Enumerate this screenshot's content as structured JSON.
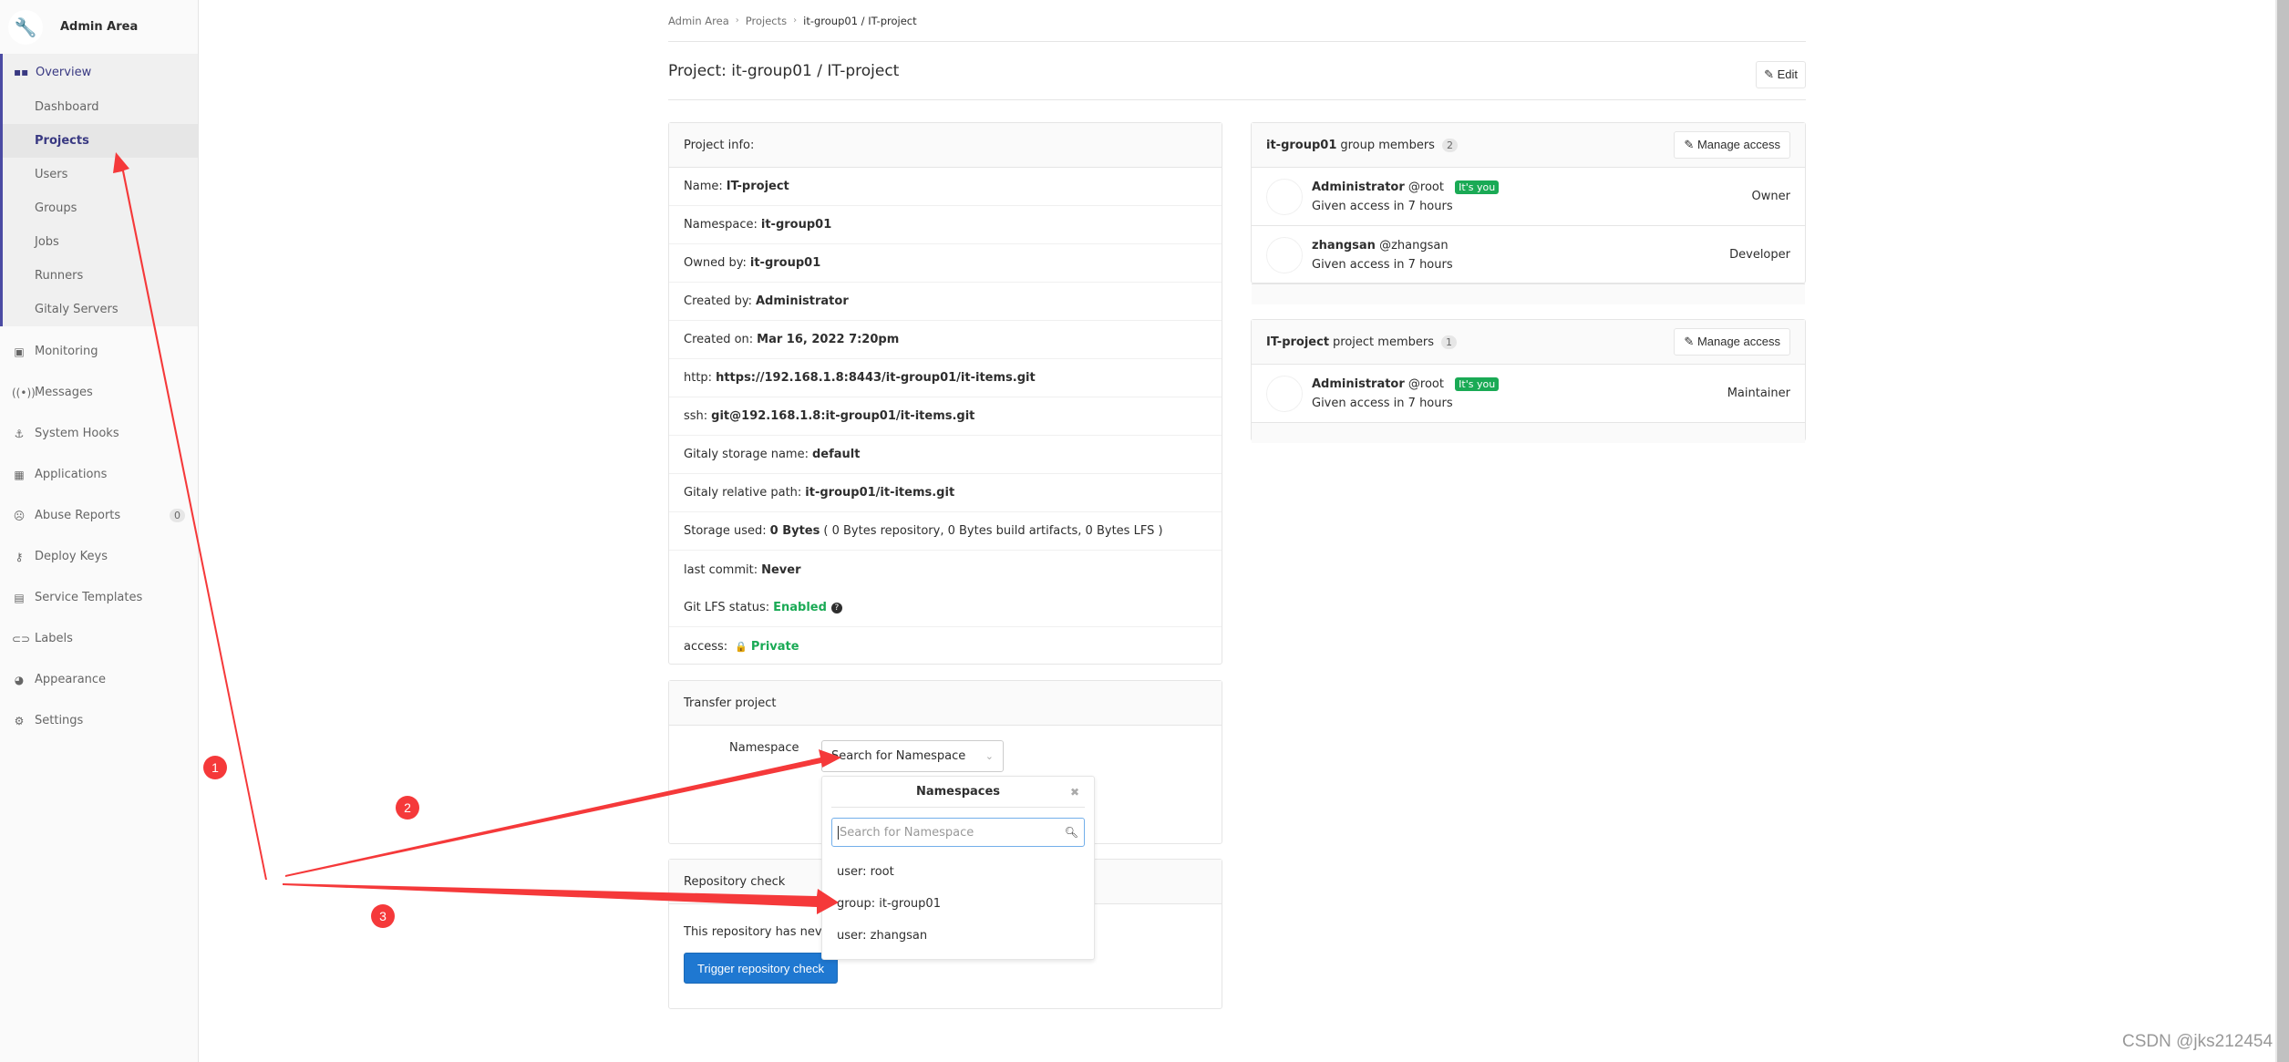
{
  "sidebar": {
    "title": "Admin Area",
    "overview_label": "Overview",
    "overview_items": [
      {
        "label": "Dashboard",
        "active": false
      },
      {
        "label": "Projects",
        "active": true
      },
      {
        "label": "Users",
        "active": false
      },
      {
        "label": "Groups",
        "active": false
      },
      {
        "label": "Jobs",
        "active": false
      },
      {
        "label": "Runners",
        "active": false
      },
      {
        "label": "Gitaly Servers",
        "active": false
      }
    ],
    "items": [
      {
        "label": "Monitoring",
        "icon": "monitor-icon"
      },
      {
        "label": "Messages",
        "icon": "broadcast-icon"
      },
      {
        "label": "System Hooks",
        "icon": "hook-icon"
      },
      {
        "label": "Applications",
        "icon": "apps-grid-icon"
      },
      {
        "label": "Abuse Reports",
        "icon": "frown-icon",
        "badge": "0"
      },
      {
        "label": "Deploy Keys",
        "icon": "key-icon"
      },
      {
        "label": "Service Templates",
        "icon": "template-icon"
      },
      {
        "label": "Labels",
        "icon": "labels-icon"
      },
      {
        "label": "Appearance",
        "icon": "palette-icon"
      },
      {
        "label": "Settings",
        "icon": "gear-icon"
      }
    ]
  },
  "breadcrumb": [
    "Admin Area",
    "Projects",
    "it-group01 / IT-project"
  ],
  "header": {
    "title": "Project: it-group01 / IT-project",
    "edit_label": "Edit"
  },
  "project_info": {
    "heading": "Project info:",
    "rows": [
      {
        "label": "Name:",
        "value": "IT-project"
      },
      {
        "label": "Namespace:",
        "value": "it-group01"
      },
      {
        "label": "Owned by:",
        "value": "it-group01"
      },
      {
        "label": "Created by:",
        "value": "Administrator"
      },
      {
        "label": "Created on:",
        "value": "Mar 16, 2022 7:20pm"
      },
      {
        "label": "http:",
        "value": "https://192.168.1.8:8443/it-group01/it-items.git"
      },
      {
        "label": "ssh:",
        "value": "git@192.168.1.8:it-group01/it-items.git"
      },
      {
        "label": "Gitaly storage name:",
        "value": "default"
      },
      {
        "label": "Gitaly relative path:",
        "value": "it-group01/it-items.git"
      },
      {
        "label": "Storage used:",
        "value": "0 Bytes",
        "extra": "( 0 Bytes repository, 0 Bytes build artifacts, 0 Bytes LFS )"
      },
      {
        "label": "last commit:",
        "value": "Never"
      }
    ],
    "lfs_label": "Git LFS status:",
    "lfs_value": "Enabled",
    "access_label": "access:",
    "access_value": "Private"
  },
  "group_members": {
    "name": "it-group01",
    "suffix": "group members",
    "count": "2",
    "manage_label": "Manage access",
    "members": [
      {
        "name": "Administrator",
        "username": "@root",
        "badge": "It's you",
        "since": "Given access in 7 hours",
        "role": "Owner"
      },
      {
        "name": "zhangsan",
        "username": "@zhangsan",
        "badge": "",
        "since": "Given access in 7 hours",
        "role": "Developer"
      }
    ]
  },
  "project_members": {
    "name": "IT-project",
    "suffix": "project members",
    "count": "1",
    "manage_label": "Manage access",
    "members": [
      {
        "name": "Administrator",
        "username": "@root",
        "badge": "It's you",
        "since": "Given access in 7 hours",
        "role": "Maintainer"
      }
    ]
  },
  "transfer": {
    "heading": "Transfer project",
    "namespace_label": "Namespace",
    "select_placeholder": "Search for Namespace"
  },
  "namespace_dropdown": {
    "title": "Namespaces",
    "search_placeholder": "Search for Namespace",
    "options": [
      "user: root",
      "group: it-group01",
      "user: zhangsan"
    ]
  },
  "repo_check": {
    "heading": "Repository check",
    "text": "This repository has never been checked.",
    "button_label": "Trigger repository check"
  },
  "annotations": {
    "color": "#f5393a",
    "markers": [
      "1",
      "2",
      "3"
    ]
  },
  "watermark": "CSDN @jks212454",
  "colors": {
    "accent": "#393982",
    "success": "#1aaa55",
    "primary_button": "#1f78d1"
  }
}
